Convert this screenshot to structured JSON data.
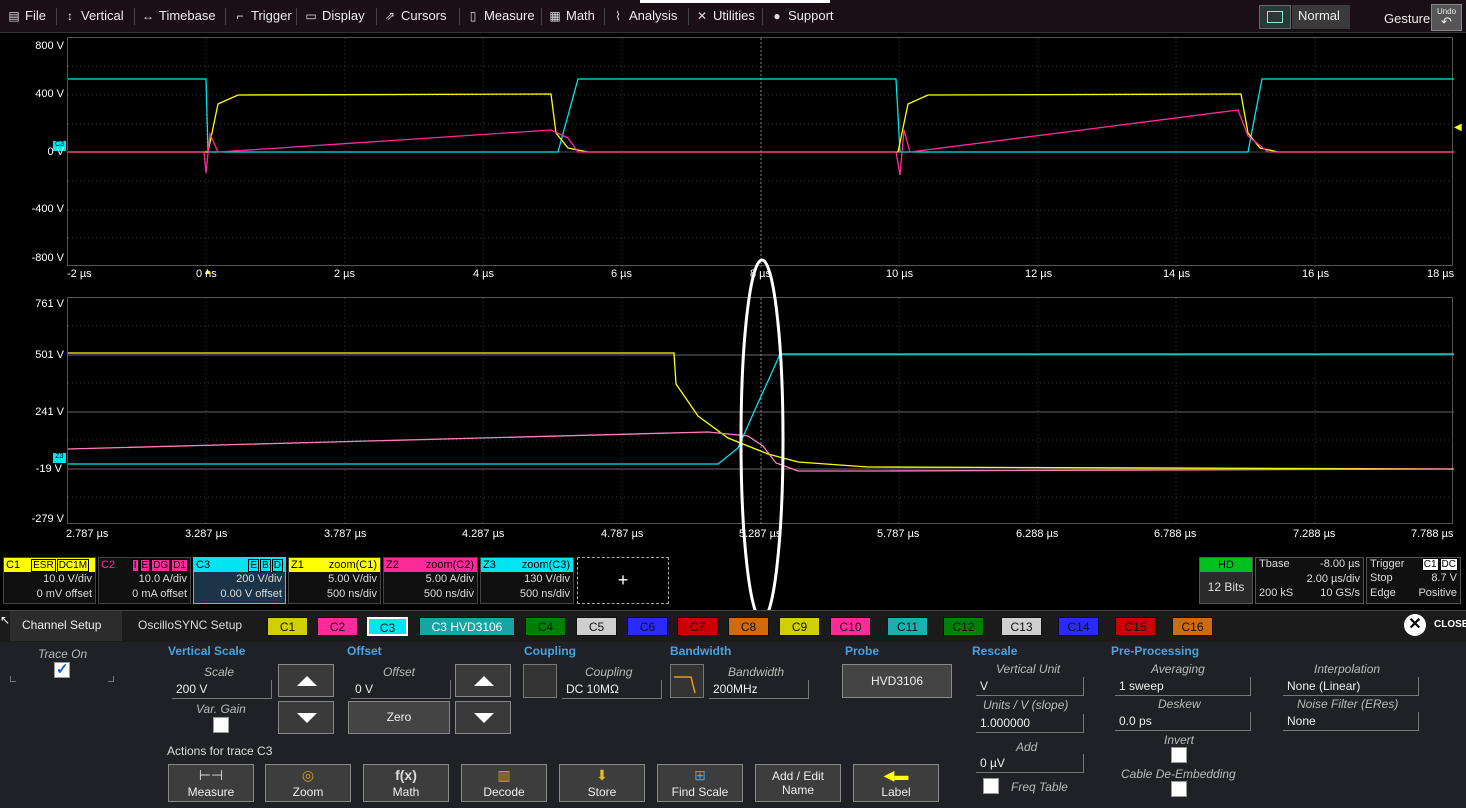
{
  "menu": {
    "file": "File",
    "vertical": "Vertical",
    "timebase": "Timebase",
    "trigger": "Trigger",
    "display": "Display",
    "cursors": "Cursors",
    "measure": "Measure",
    "math": "Math",
    "analysis": "Analysis",
    "utilities": "Utilities",
    "support": "Support",
    "mode": "Normal",
    "gesture": "Gesture",
    "undo": "Undo"
  },
  "top_grid": {
    "y_labels": [
      "800 V",
      "400 V",
      "0 V",
      "-400 V",
      "-800 V"
    ],
    "x_labels": [
      "-2 µs",
      "0 ns",
      "2 µs",
      "4 µs",
      "6 µs",
      "8 µs",
      "10 µs",
      "12 µs",
      "14 µs",
      "16 µs",
      "18 µs"
    ],
    "marker": "C3"
  },
  "zoom_grid": {
    "y_labels": [
      "761 V",
      "501 V",
      "241 V",
      "-19 V",
      "-279 V"
    ],
    "x_labels": [
      "2.787 µs",
      "3.287 µs",
      "3.787 µs",
      "4.287 µs",
      "4.787 µs",
      "5.287 µs",
      "5.787 µs",
      "6.288 µs",
      "6.788 µs",
      "7.288 µs",
      "7.788 µs"
    ],
    "marker": "Z3"
  },
  "descriptors": [
    {
      "name": "C1",
      "tags": [
        "ESR",
        "DC1M"
      ],
      "line1": "10.0 V/div",
      "line2": "0 mV offset",
      "color": "#ffff00"
    },
    {
      "name": "C2",
      "tags": [
        "I",
        "E",
        "DG",
        "D1"
      ],
      "line1": "10.0 A/div",
      "line2": "0 mA offset",
      "color": "#ff2a9a"
    },
    {
      "name": "C3",
      "tags": [
        "E",
        "B",
        "D"
      ],
      "line1": "200 V/div",
      "line2": "0.00 V offset",
      "color": "#00e5f0"
    },
    {
      "name": "Z1",
      "source": "zoom(C1)",
      "line1": "5.00 V/div",
      "line2": "500 ns/div",
      "color": "#ffff00"
    },
    {
      "name": "Z2",
      "source": "zoom(C2)",
      "line1": "5.00 A/div",
      "line2": "500 ns/div",
      "color": "#ff2a9a"
    },
    {
      "name": "Z3",
      "source": "zoom(C3)",
      "line1": "130 V/div",
      "line2": "500 ns/div",
      "color": "#00e5f0"
    }
  ],
  "add_descriptor": "+",
  "hd": {
    "label": "HD",
    "bits": "12 Bits"
  },
  "tbase": {
    "label": "Tbase",
    "delay": "-8.00 µs",
    "per_div": "2.00 µs/div",
    "samples": "200 kS",
    "rate": "10 GS/s"
  },
  "trigger": {
    "label": "Trigger",
    "ch": "C1",
    "coupling": "DC",
    "mode": "Stop",
    "level": "8.7 V",
    "type": "Edge",
    "slope": "Positive"
  },
  "tabs": {
    "channel_setup": "Channel Setup",
    "oscillosync": "OscilloSYNC Setup",
    "channels": [
      "C1",
      "C2",
      "C3",
      "C3 HVD3106",
      "C4",
      "C5",
      "C6",
      "C7",
      "C8",
      "C9",
      "C10",
      "C11",
      "C12",
      "C13",
      "C14",
      "C15",
      "C16"
    ],
    "close": "CLOSE"
  },
  "setup": {
    "trace_on": "Trace On",
    "vertical_scale": "Vertical Scale",
    "scale_label": "Scale",
    "scale_value": "200 V",
    "var_gain": "Var. Gain",
    "offset": "Offset",
    "offset_label": "Offset",
    "offset_value": "0 V",
    "zero": "Zero",
    "coupling": "Coupling",
    "coupling_label": "Coupling",
    "coupling_value": "DC 10MΩ",
    "bandwidth": "Bandwidth",
    "bandwidth_label": "Bandwidth",
    "bandwidth_value": "200MHz",
    "probe": "Probe",
    "probe_value": "HVD3106",
    "rescale": "Rescale",
    "vertical_unit_label": "Vertical Unit",
    "vertical_unit_value": "V",
    "units_slope_label": "Units / V (slope)",
    "units_slope_value": "1.000000",
    "add_label": "Add",
    "add_value": "0 µV",
    "freq_table": "Freq Table",
    "preproc": "Pre-Processing",
    "averaging_label": "Averaging",
    "averaging_value": "1 sweep",
    "deskew_label": "Deskew",
    "deskew_value": "0.0 ps",
    "invert": "Invert",
    "cable_deembed": "Cable De-Embedding",
    "interp_label": "Interpolation",
    "interp_value": "None (Linear)",
    "noise_label": "Noise Filter (ERes)",
    "noise_value": "None",
    "actions_label": "Actions for trace C3",
    "actions": [
      "Measure",
      "Zoom",
      "Math",
      "Decode",
      "Store",
      "Find Scale",
      "Add / Edit Name",
      "Label"
    ]
  },
  "colors": {
    "c1": "#ffff00",
    "c2": "#ff2a9a",
    "c3": "#00e5f0",
    "accent": "#4aa3df"
  }
}
